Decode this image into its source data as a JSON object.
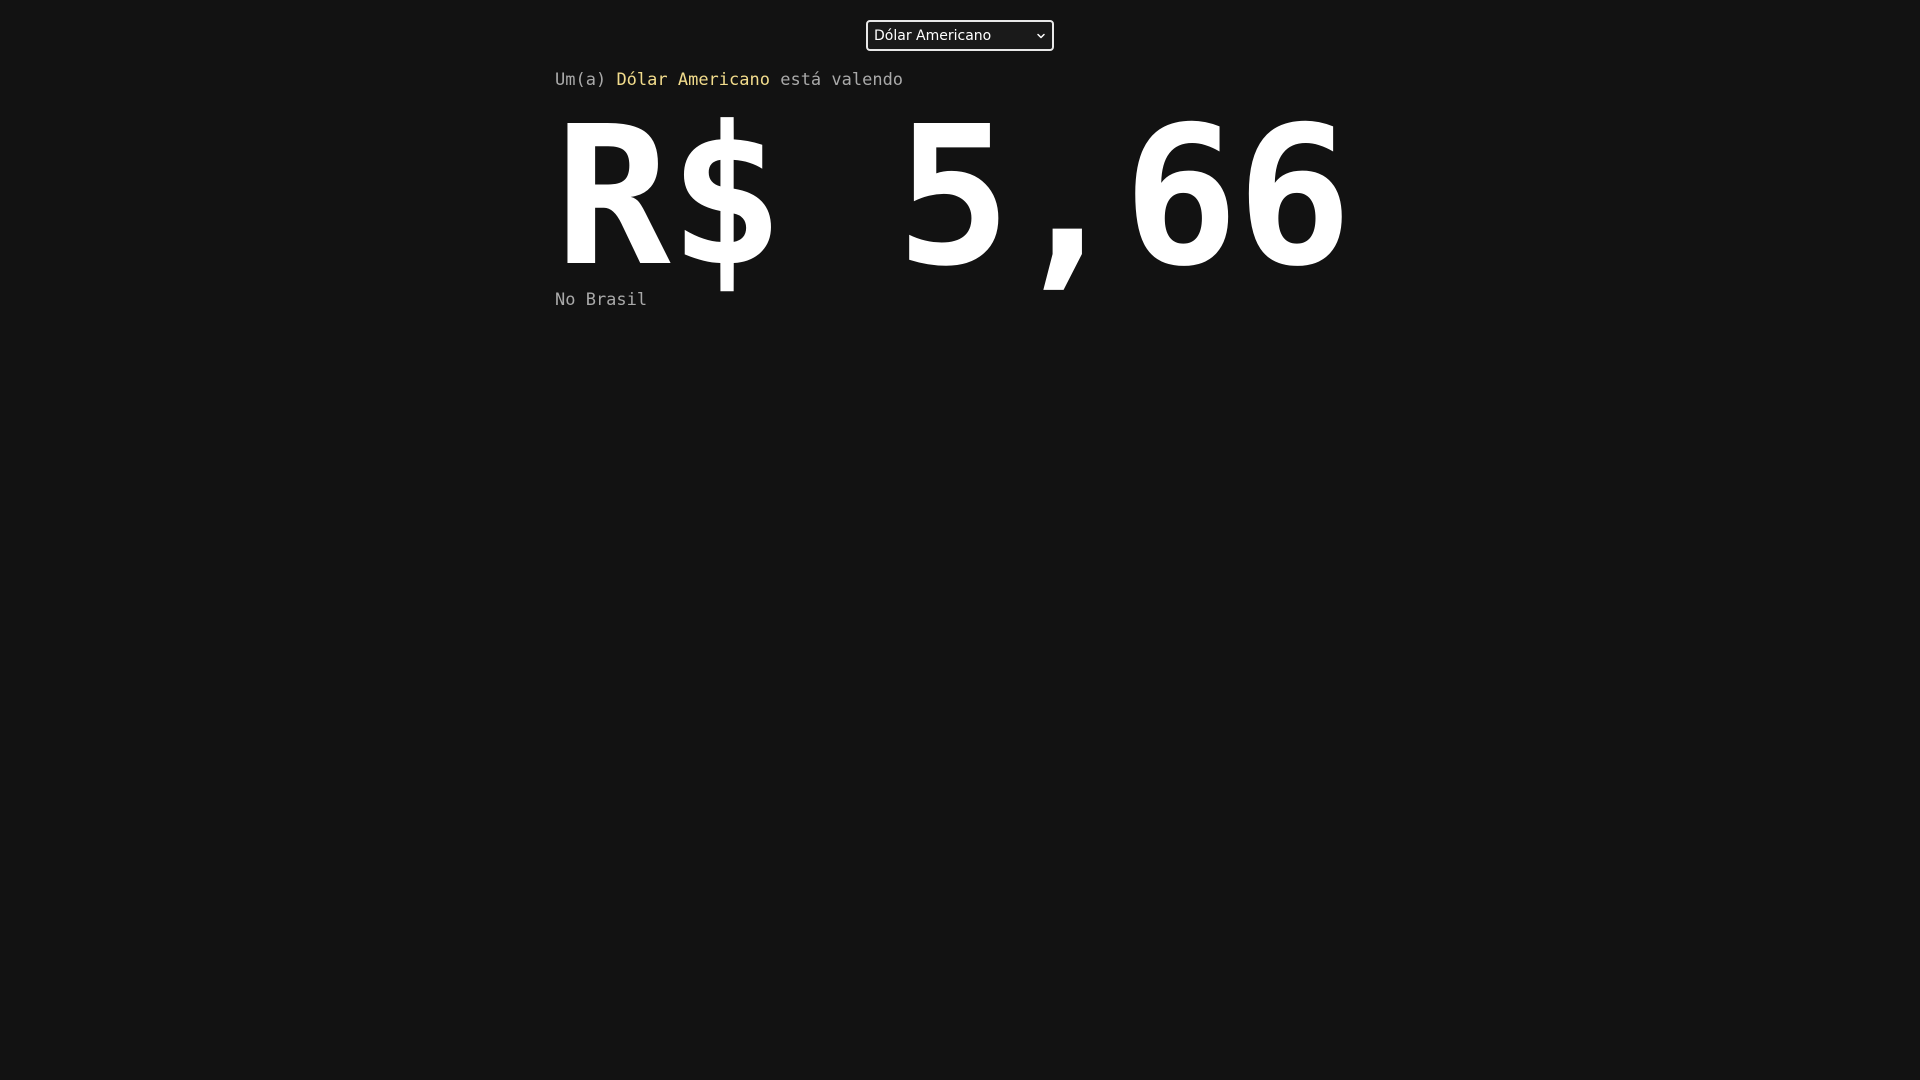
{
  "selector": {
    "selected": "Dólar Americano",
    "icon": "chevron-down-icon"
  },
  "intro": {
    "prefix": "Um(a)",
    "currency": "Dólar Americano",
    "suffix": "está valendo"
  },
  "price": "R$ 5,66",
  "location": "No Brasil",
  "colors": {
    "background": "#121212",
    "highlight": "#f2dc8c",
    "muted": "#a9a9a9",
    "text": "#ffffff"
  }
}
